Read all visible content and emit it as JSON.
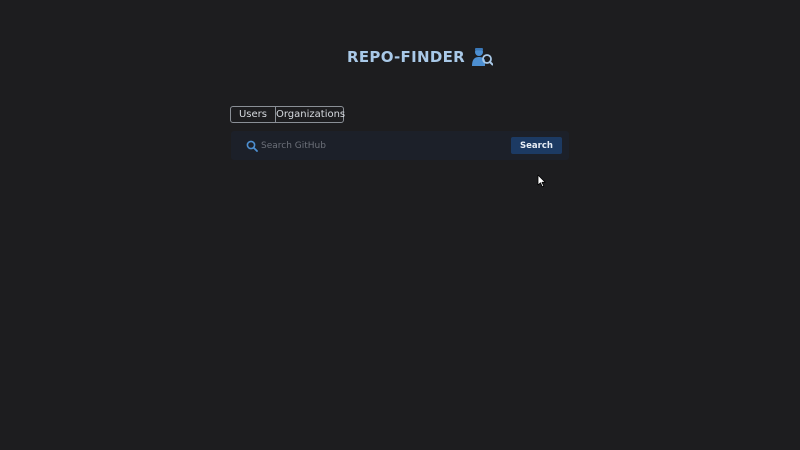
{
  "header": {
    "title": "REPO-FINDER",
    "icon": "user-search-icon",
    "accent_color": "#a9c9e8"
  },
  "tabs": [
    {
      "label": "Users"
    },
    {
      "label": "Organizations"
    }
  ],
  "search": {
    "placeholder": "Search GitHub",
    "value": "",
    "button_label": "Search",
    "icon": "search-icon",
    "button_color": "#1c3a63"
  }
}
